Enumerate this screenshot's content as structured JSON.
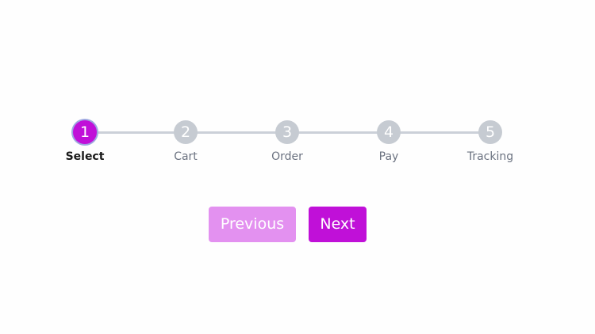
{
  "stepper": {
    "current_step": 1,
    "steps": [
      {
        "number": "1",
        "label": "Select"
      },
      {
        "number": "2",
        "label": "Cart"
      },
      {
        "number": "3",
        "label": "Order"
      },
      {
        "number": "4",
        "label": "Pay"
      },
      {
        "number": "5",
        "label": "Tracking"
      }
    ]
  },
  "buttons": {
    "previous": "Previous",
    "next": "Next"
  },
  "colors": {
    "accent": "#c010d8",
    "accent_disabled": "#e391f0",
    "inactive": "#c6cbd2",
    "track": "#cbd0d8"
  }
}
